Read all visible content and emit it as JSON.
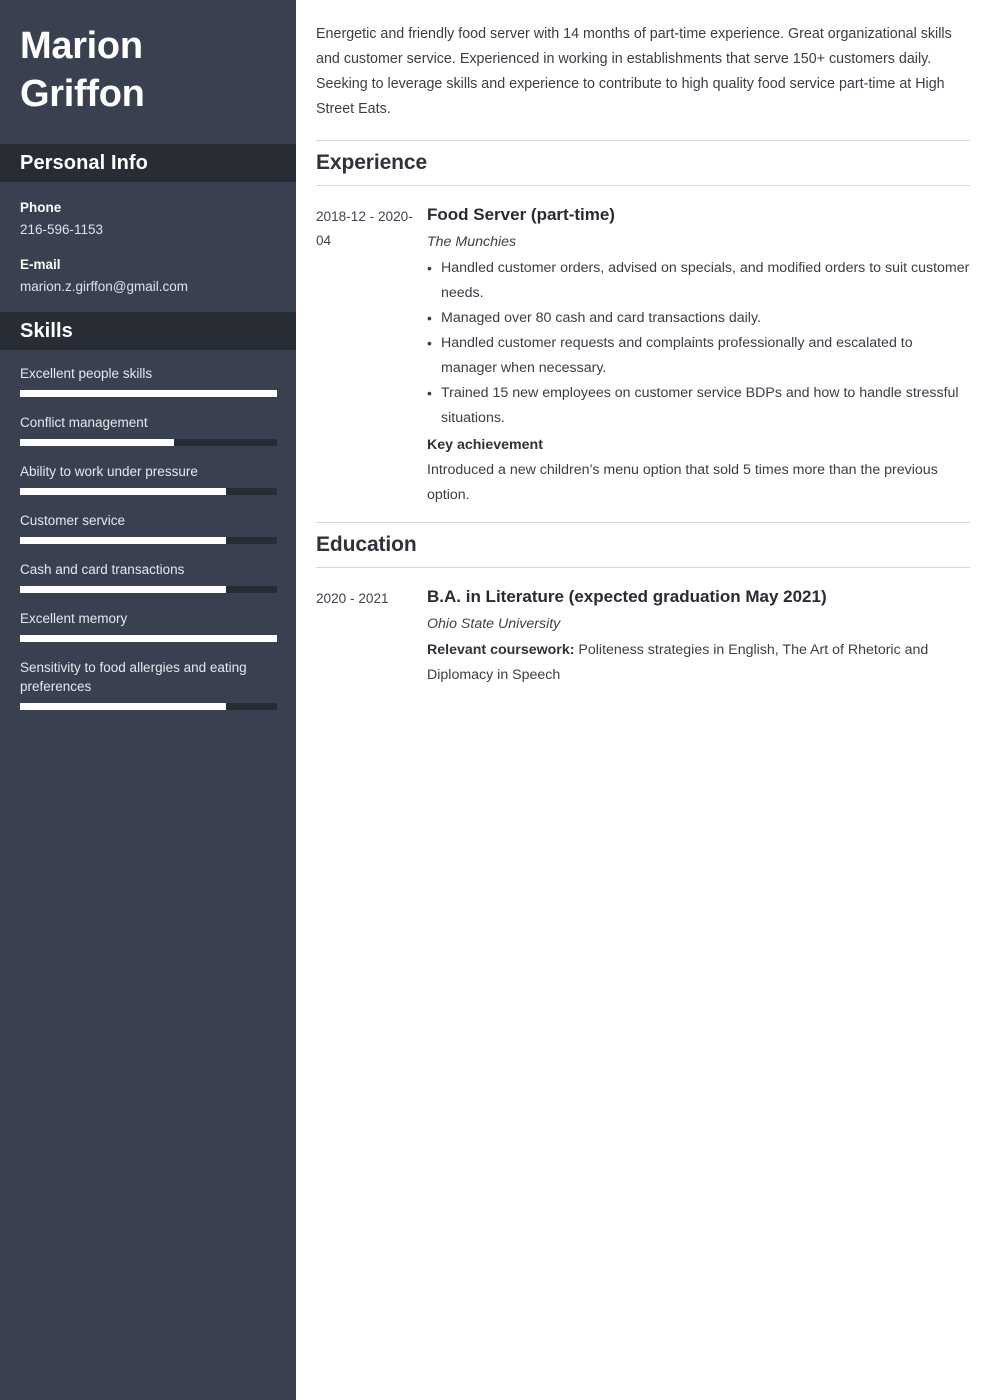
{
  "colors": {
    "sidebar_bg": "#39404f",
    "sidebar_band_bg": "#282c35",
    "sidebar_text": "#ffffff",
    "skill_fill": "#ffffff",
    "skill_track": "#282c35",
    "main_text": "#3a3e46",
    "rule": "#d8d8d8"
  },
  "sidebar": {
    "name_first": "Marion",
    "name_last": "Griffon",
    "personal_info": {
      "heading": "Personal Info",
      "items": [
        {
          "label": "Phone",
          "value": "216-596-1153"
        },
        {
          "label": "E-mail",
          "value": "marion.z.girffon@gmail.com"
        }
      ]
    },
    "skills": {
      "heading": "Skills",
      "items": [
        {
          "label": "Excellent people skills",
          "level": 100
        },
        {
          "label": "Conflict management",
          "level": 60
        },
        {
          "label": "Ability to work under pressure",
          "level": 80
        },
        {
          "label": "Customer service",
          "level": 80
        },
        {
          "label": "Cash and card transactions",
          "level": 80
        },
        {
          "label": "Excellent memory",
          "level": 100
        },
        {
          "label": "Sensitivity to food allergies and eating preferences",
          "level": 80
        }
      ]
    }
  },
  "main": {
    "summary": "Energetic and friendly food server with 14 months of part-time experience. Great organizational skills and customer service. Experienced in working in establishments that serve 150+ customers daily. Seeking to leverage skills and experience to contribute to high quality food service part-time at High Street Eats.",
    "experience": {
      "heading": "Experience",
      "entries": [
        {
          "dates": "2018-12 - 2020-04",
          "title": "Food Server (part-time)",
          "organization": "The Munchies",
          "bullets": [
            "Handled customer orders, advised on specials, and modified orders to suit customer needs.",
            "Managed over 80 cash and card transactions daily.",
            "Handled customer requests and complaints professionally and escalated to manager when necessary.",
            "Trained 15 new employees on customer service BDPs and how to handle stressful situations."
          ],
          "achievement_label": "Key achievement",
          "achievement_text": "Introduced a new children’s menu option that sold 5 times more than the previous option."
        }
      ]
    },
    "education": {
      "heading": "Education",
      "entries": [
        {
          "dates": "2020 - 2021",
          "title": "B.A. in Literature (expected graduation May 2021)",
          "organization": "Ohio State University",
          "coursework_label": "Relevant coursework:",
          "coursework_text": "Politeness strategies in English, The Art of Rhetoric and Diplomacy in Speech"
        }
      ]
    }
  }
}
